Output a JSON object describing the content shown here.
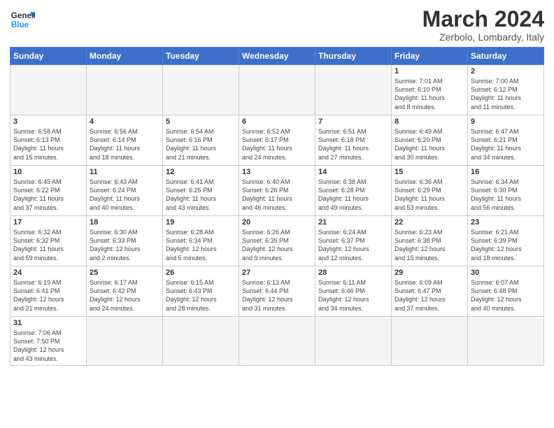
{
  "logo": {
    "text_general": "General",
    "text_blue": "Blue"
  },
  "header": {
    "title": "March 2024",
    "subtitle": "Zerbolo, Lombardy, Italy"
  },
  "weekdays": [
    "Sunday",
    "Monday",
    "Tuesday",
    "Wednesday",
    "Thursday",
    "Friday",
    "Saturday"
  ],
  "weeks": [
    {
      "days": [
        {
          "num": "",
          "info": "",
          "empty": true
        },
        {
          "num": "",
          "info": "",
          "empty": true
        },
        {
          "num": "",
          "info": "",
          "empty": true
        },
        {
          "num": "",
          "info": "",
          "empty": true
        },
        {
          "num": "",
          "info": "",
          "empty": true
        },
        {
          "num": "1",
          "info": "Sunrise: 7:01 AM\nSunset: 6:10 PM\nDaylight: 11 hours\nand 8 minutes."
        },
        {
          "num": "2",
          "info": "Sunrise: 7:00 AM\nSunset: 6:12 PM\nDaylight: 11 hours\nand 11 minutes."
        }
      ]
    },
    {
      "days": [
        {
          "num": "3",
          "info": "Sunrise: 6:58 AM\nSunset: 6:13 PM\nDaylight: 11 hours\nand 15 minutes."
        },
        {
          "num": "4",
          "info": "Sunrise: 6:56 AM\nSunset: 6:14 PM\nDaylight: 11 hours\nand 18 minutes."
        },
        {
          "num": "5",
          "info": "Sunrise: 6:54 AM\nSunset: 6:16 PM\nDaylight: 11 hours\nand 21 minutes."
        },
        {
          "num": "6",
          "info": "Sunrise: 6:52 AM\nSunset: 6:17 PM\nDaylight: 11 hours\nand 24 minutes."
        },
        {
          "num": "7",
          "info": "Sunrise: 6:51 AM\nSunset: 6:18 PM\nDaylight: 11 hours\nand 27 minutes."
        },
        {
          "num": "8",
          "info": "Sunrise: 6:49 AM\nSunset: 6:20 PM\nDaylight: 11 hours\nand 30 minutes."
        },
        {
          "num": "9",
          "info": "Sunrise: 6:47 AM\nSunset: 6:21 PM\nDaylight: 11 hours\nand 34 minutes."
        }
      ]
    },
    {
      "days": [
        {
          "num": "10",
          "info": "Sunrise: 6:45 AM\nSunset: 6:22 PM\nDaylight: 11 hours\nand 37 minutes."
        },
        {
          "num": "11",
          "info": "Sunrise: 6:43 AM\nSunset: 6:24 PM\nDaylight: 11 hours\nand 40 minutes."
        },
        {
          "num": "12",
          "info": "Sunrise: 6:41 AM\nSunset: 6:25 PM\nDaylight: 11 hours\nand 43 minutes."
        },
        {
          "num": "13",
          "info": "Sunrise: 6:40 AM\nSunset: 6:26 PM\nDaylight: 11 hours\nand 46 minutes."
        },
        {
          "num": "14",
          "info": "Sunrise: 6:38 AM\nSunset: 6:28 PM\nDaylight: 11 hours\nand 49 minutes."
        },
        {
          "num": "15",
          "info": "Sunrise: 6:36 AM\nSunset: 6:29 PM\nDaylight: 11 hours\nand 53 minutes."
        },
        {
          "num": "16",
          "info": "Sunrise: 6:34 AM\nSunset: 6:30 PM\nDaylight: 11 hours\nand 56 minutes."
        }
      ]
    },
    {
      "days": [
        {
          "num": "17",
          "info": "Sunrise: 6:32 AM\nSunset: 6:32 PM\nDaylight: 11 hours\nand 59 minutes."
        },
        {
          "num": "18",
          "info": "Sunrise: 6:30 AM\nSunset: 6:33 PM\nDaylight: 12 hours\nand 2 minutes."
        },
        {
          "num": "19",
          "info": "Sunrise: 6:28 AM\nSunset: 6:34 PM\nDaylight: 12 hours\nand 5 minutes."
        },
        {
          "num": "20",
          "info": "Sunrise: 6:26 AM\nSunset: 6:35 PM\nDaylight: 12 hours\nand 9 minutes."
        },
        {
          "num": "21",
          "info": "Sunrise: 6:24 AM\nSunset: 6:37 PM\nDaylight: 12 hours\nand 12 minutes."
        },
        {
          "num": "22",
          "info": "Sunrise: 6:23 AM\nSunset: 6:38 PM\nDaylight: 12 hours\nand 15 minutes."
        },
        {
          "num": "23",
          "info": "Sunrise: 6:21 AM\nSunset: 6:39 PM\nDaylight: 12 hours\nand 18 minutes."
        }
      ]
    },
    {
      "days": [
        {
          "num": "24",
          "info": "Sunrise: 6:19 AM\nSunset: 6:41 PM\nDaylight: 12 hours\nand 21 minutes."
        },
        {
          "num": "25",
          "info": "Sunrise: 6:17 AM\nSunset: 6:42 PM\nDaylight: 12 hours\nand 24 minutes."
        },
        {
          "num": "26",
          "info": "Sunrise: 6:15 AM\nSunset: 6:43 PM\nDaylight: 12 hours\nand 28 minutes."
        },
        {
          "num": "27",
          "info": "Sunrise: 6:13 AM\nSunset: 6:44 PM\nDaylight: 12 hours\nand 31 minutes."
        },
        {
          "num": "28",
          "info": "Sunrise: 6:11 AM\nSunset: 6:46 PM\nDaylight: 12 hours\nand 34 minutes."
        },
        {
          "num": "29",
          "info": "Sunrise: 6:09 AM\nSunset: 6:47 PM\nDaylight: 12 hours\nand 37 minutes."
        },
        {
          "num": "30",
          "info": "Sunrise: 6:07 AM\nSunset: 6:48 PM\nDaylight: 12 hours\nand 40 minutes."
        }
      ]
    },
    {
      "days": [
        {
          "num": "31",
          "info": "Sunrise: 7:06 AM\nSunset: 7:50 PM\nDaylight: 12 hours\nand 43 minutes."
        },
        {
          "num": "",
          "info": "",
          "empty": true
        },
        {
          "num": "",
          "info": "",
          "empty": true
        },
        {
          "num": "",
          "info": "",
          "empty": true
        },
        {
          "num": "",
          "info": "",
          "empty": true
        },
        {
          "num": "",
          "info": "",
          "empty": true
        },
        {
          "num": "",
          "info": "",
          "empty": true
        }
      ]
    }
  ]
}
